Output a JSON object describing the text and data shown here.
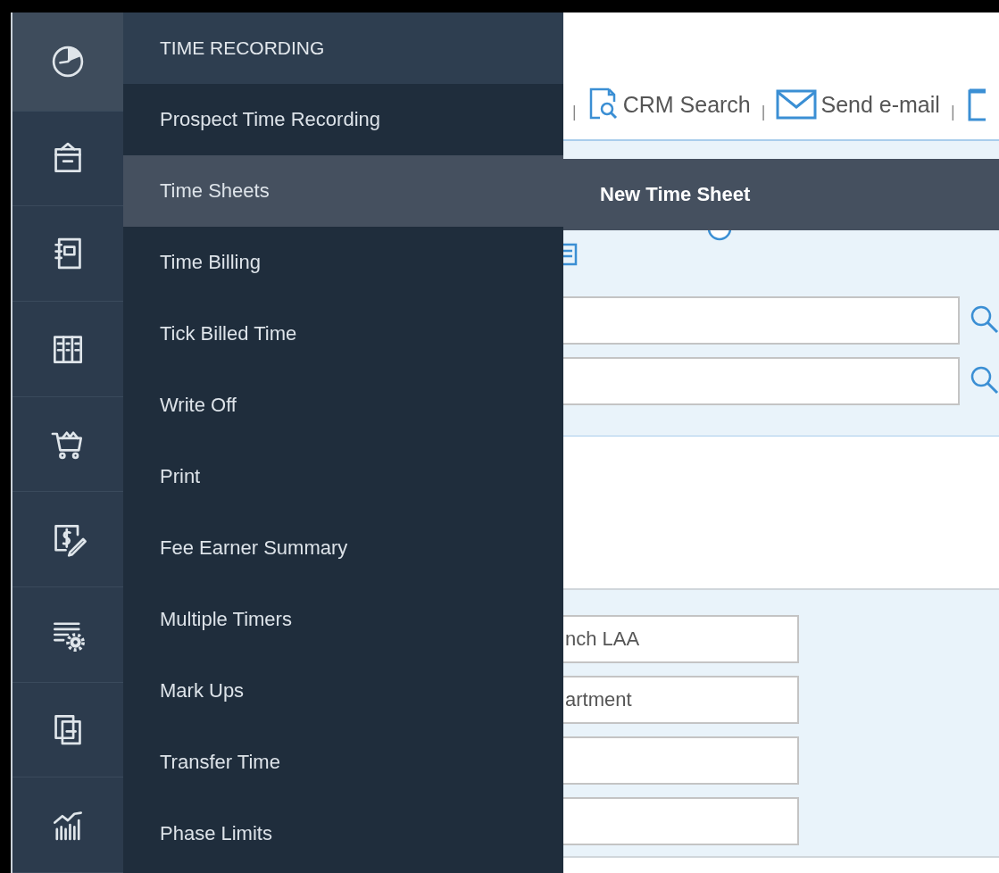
{
  "rail": [
    {
      "kind": "clock",
      "selected": true
    },
    {
      "kind": "box",
      "selected": false
    },
    {
      "kind": "notebook",
      "selected": false
    },
    {
      "kind": "ledger",
      "selected": false
    },
    {
      "kind": "cart",
      "selected": false
    },
    {
      "kind": "invoice",
      "selected": false
    },
    {
      "kind": "settings",
      "selected": false
    },
    {
      "kind": "copy",
      "selected": false
    },
    {
      "kind": "chart",
      "selected": false
    }
  ],
  "menu": {
    "title": "TIME RECORDING",
    "items": [
      {
        "label": "Prospect Time Recording",
        "selected": false
      },
      {
        "label": "Time Sheets",
        "selected": true
      },
      {
        "label": "Time Billing",
        "selected": false
      },
      {
        "label": "Tick Billed Time",
        "selected": false
      },
      {
        "label": "Write Off",
        "selected": false
      },
      {
        "label": "Print",
        "selected": false
      },
      {
        "label": "Fee Earner Summary",
        "selected": false
      },
      {
        "label": "Multiple Timers",
        "selected": false
      },
      {
        "label": "Mark Ups",
        "selected": false
      },
      {
        "label": "Transfer Time",
        "selected": false
      },
      {
        "label": "Phase Limits",
        "selected": false
      }
    ]
  },
  "submenu": {
    "items": [
      "New Time Sheet"
    ]
  },
  "toolbar": [
    {
      "kind": "crm",
      "separator": "|",
      "label": "CRM Search"
    },
    {
      "kind": "mail",
      "separator": "|",
      "label": "Send e-mail"
    },
    {
      "kind": "doc",
      "separator": "|"
    }
  ],
  "radio": {
    "selected": false
  },
  "search_fields": [
    {
      "kind": "search"
    },
    {
      "kind": "search"
    }
  ],
  "detail_fields": [
    {
      "kind": "text",
      "value": "nch LAA"
    },
    {
      "kind": "text",
      "value": "artment"
    },
    {
      "kind": "text"
    },
    {
      "kind": "text"
    }
  ]
}
